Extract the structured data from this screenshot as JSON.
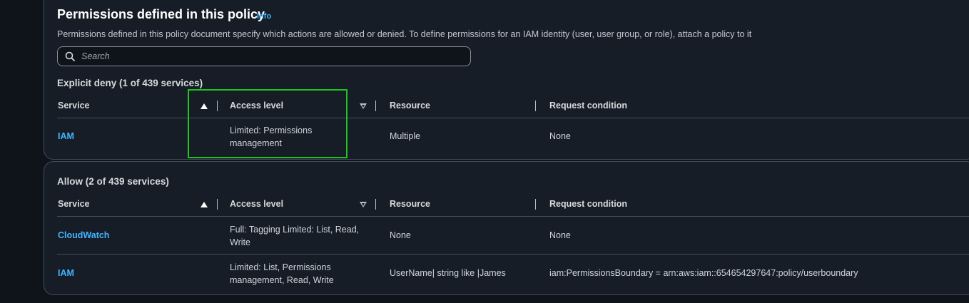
{
  "header": {
    "title": "Permissions defined in this policy",
    "info_label": "Info",
    "description": "Permissions defined in this policy document specify which actions are allowed or denied. To define permissions for an IAM identity (user, user group, or role), attach a policy to it"
  },
  "search": {
    "placeholder": "Search"
  },
  "columns": {
    "service": "Service",
    "access_level": "Access level",
    "resource": "Resource",
    "request_condition": "Request condition"
  },
  "explicit_deny": {
    "title": "Explicit deny (1 of 439 services)",
    "rows": [
      {
        "service": "IAM",
        "access_level": "Limited: Permissions management",
        "resource": "Multiple",
        "request_condition": "None"
      }
    ]
  },
  "allow": {
    "title": "Allow (2 of 439 services)",
    "rows": [
      {
        "service": "CloudWatch",
        "access_level": "Full: Tagging Limited: List, Read, Write",
        "resource": "None",
        "request_condition": "None"
      },
      {
        "service": "IAM",
        "access_level": "Limited: List, Permissions management, Read, Write",
        "resource": "UserName| string like |James",
        "request_condition": "iam:PermissionsBoundary = arn:aws:iam::654654297647:policy/userboundary"
      }
    ]
  },
  "colors": {
    "background": "#0f141a",
    "panel": "#161d26",
    "link": "#42b4ff",
    "highlight": "#1fc51f"
  }
}
